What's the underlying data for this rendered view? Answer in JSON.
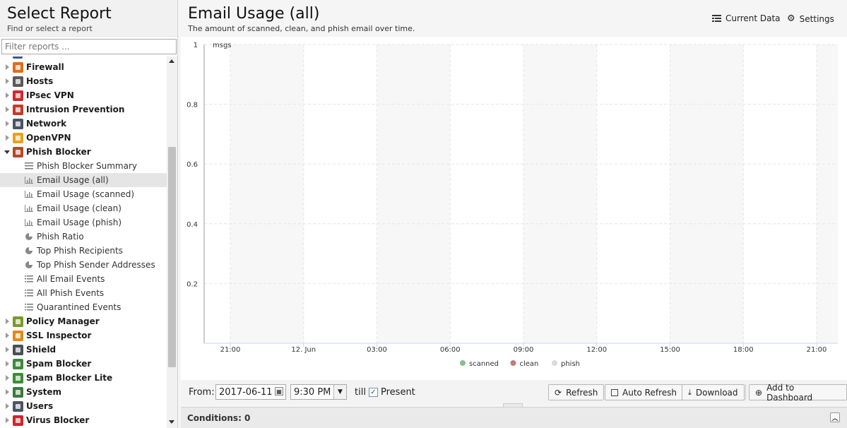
{
  "left": {
    "title": "Select Report",
    "subtitle": "Find or select a report",
    "filter_placeholder": "Filter reports ..."
  },
  "tree": [
    {
      "type": "app",
      "label": "Firewall",
      "icon": "firewall-icon",
      "color": "#e06d19",
      "expanded": false
    },
    {
      "type": "app",
      "label": "Hosts",
      "icon": "hosts-icon",
      "color": "#5a5a5a",
      "expanded": false
    },
    {
      "type": "app",
      "label": "IPsec VPN",
      "icon": "ipsec-vpn-icon",
      "color": "#d4262c",
      "expanded": false
    },
    {
      "type": "app",
      "label": "Intrusion Prevention",
      "icon": "intrusion-prevention-icon",
      "color": "#c43a2c",
      "expanded": false
    },
    {
      "type": "app",
      "label": "Network",
      "icon": "network-icon",
      "color": "#4a5563",
      "expanded": false
    },
    {
      "type": "app",
      "label": "OpenVPN",
      "icon": "openvpn-icon",
      "color": "#e8a21f",
      "expanded": false
    },
    {
      "type": "app",
      "label": "Phish Blocker",
      "icon": "phish-blocker-icon",
      "color": "#b24b2c",
      "expanded": true
    },
    {
      "type": "child",
      "label": "Phish Blocker Summary",
      "icon": "text-report-icon",
      "selected": false
    },
    {
      "type": "child",
      "label": "Email Usage (all)",
      "icon": "bar-chart-icon",
      "selected": true
    },
    {
      "type": "child",
      "label": "Email Usage (scanned)",
      "icon": "bar-chart-icon",
      "selected": false
    },
    {
      "type": "child",
      "label": "Email Usage (clean)",
      "icon": "bar-chart-icon",
      "selected": false
    },
    {
      "type": "child",
      "label": "Email Usage (phish)",
      "icon": "bar-chart-icon",
      "selected": false
    },
    {
      "type": "child",
      "label": "Phish Ratio",
      "icon": "pie-chart-icon",
      "selected": false
    },
    {
      "type": "child",
      "label": "Top Phish Recipients",
      "icon": "pie-chart-icon",
      "selected": false
    },
    {
      "type": "child",
      "label": "Top Phish Sender Addresses",
      "icon": "pie-chart-icon",
      "selected": false
    },
    {
      "type": "child",
      "label": "All Email Events",
      "icon": "list-icon",
      "selected": false
    },
    {
      "type": "child",
      "label": "All Phish Events",
      "icon": "list-icon",
      "selected": false
    },
    {
      "type": "child",
      "label": "Quarantined Events",
      "icon": "list-icon",
      "selected": false
    },
    {
      "type": "app",
      "label": "Policy Manager",
      "icon": "policy-manager-icon",
      "color": "#7a9a2c",
      "expanded": false
    },
    {
      "type": "app",
      "label": "SSL Inspector",
      "icon": "ssl-inspector-icon",
      "color": "#e08a1a",
      "expanded": false
    },
    {
      "type": "app",
      "label": "Shield",
      "icon": "shield-icon",
      "color": "#4b4f55",
      "expanded": false
    },
    {
      "type": "app",
      "label": "Spam Blocker",
      "icon": "spam-blocker-icon",
      "color": "#3f8a3a",
      "expanded": false
    },
    {
      "type": "app",
      "label": "Spam Blocker Lite",
      "icon": "spam-blocker-lite-icon",
      "color": "#3f8a3a",
      "expanded": false
    },
    {
      "type": "app",
      "label": "System",
      "icon": "system-icon",
      "color": "#3c7a3c",
      "expanded": false
    },
    {
      "type": "app",
      "label": "Users",
      "icon": "users-icon",
      "color": "#4a5563",
      "expanded": false
    },
    {
      "type": "app",
      "label": "Virus Blocker",
      "icon": "virus-blocker-icon",
      "color": "#d0242a",
      "expanded": false
    }
  ],
  "report": {
    "title": "Email Usage (all)",
    "description": "The amount of scanned, clean, and phish email over time.",
    "current_data_label": "Current Data",
    "settings_label": "Settings"
  },
  "chart_data": {
    "type": "line",
    "title": "",
    "ylabel": "msgs",
    "xlabel": "",
    "ylim": [
      0,
      1
    ],
    "y_ticks": [
      "0.2",
      "0.4",
      "0.6",
      "0.8",
      "1"
    ],
    "x_ticks": [
      "21:00",
      "12. Jun",
      "03:00",
      "06:00",
      "09:00",
      "12:00",
      "15:00",
      "18:00",
      "21:00"
    ],
    "series": [
      {
        "name": "scanned",
        "color": "#8bbf8f",
        "values": []
      },
      {
        "name": "clean",
        "color": "#c47a7a",
        "values": []
      },
      {
        "name": "phish",
        "color": "#dcdcdc",
        "values": []
      }
    ],
    "legend": "bottom-center",
    "grid": true
  },
  "toolbar": {
    "from_label": "From:",
    "from_date": "2017-06-11",
    "from_time": "9:30 PM",
    "till_label": "till",
    "present_label": "Present",
    "present_checked": true,
    "refresh_label": "Refresh",
    "auto_refresh_label": "Auto Refresh",
    "download_label": "Download",
    "add_dashboard_label": "Add to Dashboard"
  },
  "conditions": {
    "label": "Conditions: 0"
  }
}
